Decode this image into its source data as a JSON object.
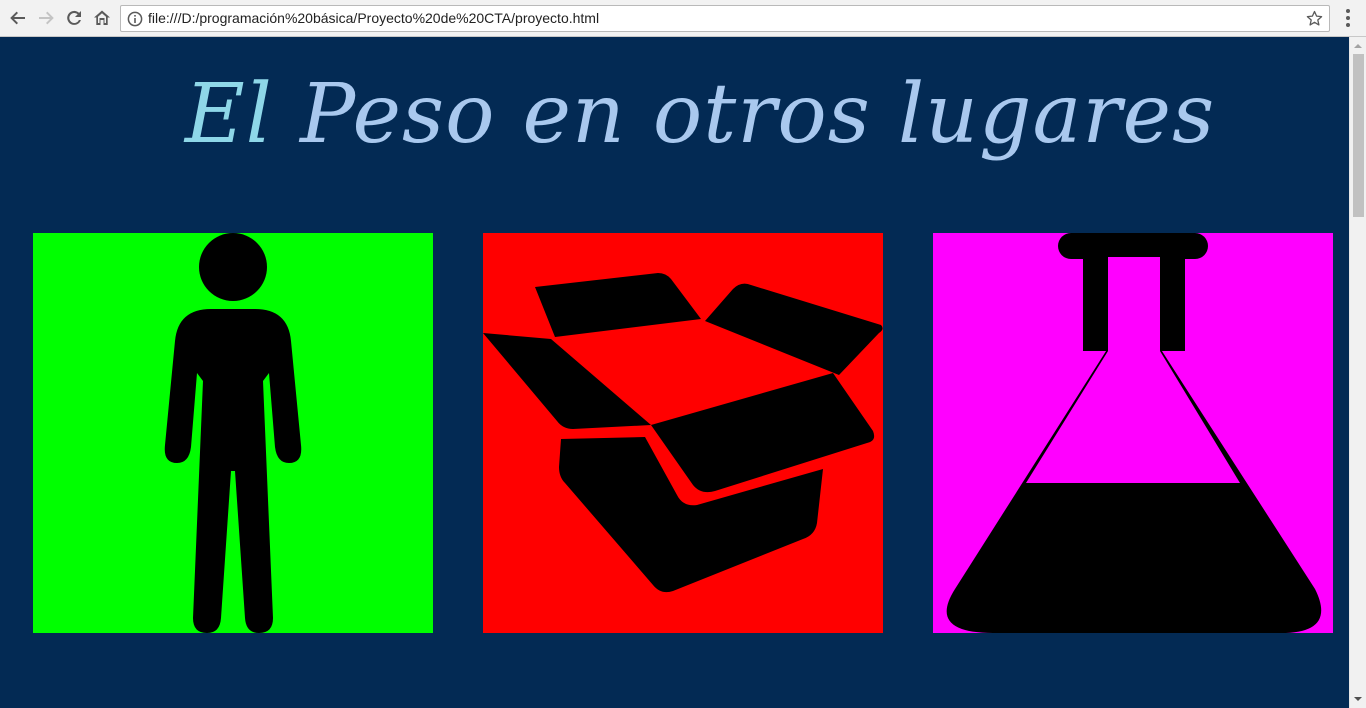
{
  "browser": {
    "url": "file:///D:/programación%20básica/Proyecto%20de%20CTA/proyecto.html",
    "icons": [
      "back-arrow-icon",
      "forward-arrow-icon",
      "reload-icon",
      "home-icon",
      "info-icon",
      "bookmark-star-icon",
      "menu-dots-icon"
    ]
  },
  "page": {
    "title_first": "El",
    "title_rest": " Peso en otros lugares",
    "background_color": "#032a54",
    "title_color": "#a9c8ee"
  },
  "tiles": [
    {
      "name": "person",
      "background": "#00ff00",
      "icon": "person-icon"
    },
    {
      "name": "box",
      "background": "#ff0000",
      "icon": "open-box-icon"
    },
    {
      "name": "flask",
      "background": "#ff00ff",
      "icon": "flask-icon"
    }
  ]
}
